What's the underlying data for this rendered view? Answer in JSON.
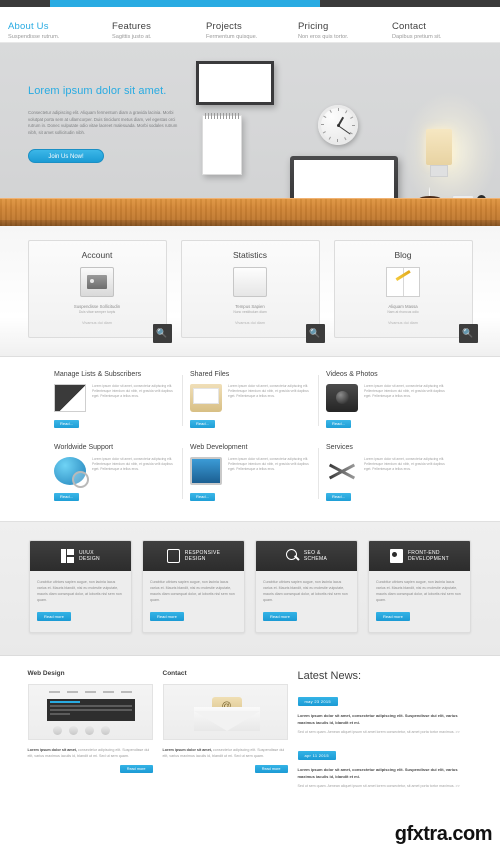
{
  "theme": {
    "accent": "#29abe2",
    "dark": "#3a3a3a",
    "muted": "#a3a3a3"
  },
  "nav": {
    "items": [
      {
        "label": "About Us",
        "sub": "Suspendisse rutrum.",
        "active": true
      },
      {
        "label": "Features",
        "sub": "Sagittis justo at.",
        "active": false
      },
      {
        "label": "Projects",
        "sub": "Fermentum quisque.",
        "active": false
      },
      {
        "label": "Pricing",
        "sub": "Non eros quis tortor.",
        "active": false
      },
      {
        "label": "Contact",
        "sub": "Dapibus pretium sit.",
        "active": false
      }
    ]
  },
  "hero": {
    "title": "Lorem ipsum dolor sit amet.",
    "text": "Consectetur adipiscing elit. Aliquam fermentum diam a gravida lacinia. Morbi volutpat porta sem at ullamcorper. Duis tincidunt metus diam, vel egestas orci rutrum in. Donec vulputate odio vitae laoreet malesuada. Morbi sodales rutrum nibh, sit amet sollicitudin nibh.",
    "button": "Join Us Now!",
    "objects": {
      "picture_frame": "framed-picture",
      "notepad": "spiral-notepad",
      "clock": "wall-clock",
      "monitor": "desktop-monitor",
      "lamp": "wall-lamp",
      "coffee": "coffee-cup",
      "outlet": "power-outlet"
    }
  },
  "cards3": [
    {
      "title": "Account",
      "icon": "safe-icon",
      "line1": "Suspendisse Sollicitudin",
      "line2": "Duis vitae semper turpis",
      "line3": "Vivamus dui diam",
      "search": "search-icon"
    },
    {
      "title": "Statistics",
      "icon": "chart-monitor-icon",
      "line1": "Tempus Sapien",
      "line2": "Nunc vestibulum diam",
      "line3": "Vivamus dui diam",
      "search": "search-icon"
    },
    {
      "title": "Blog",
      "icon": "notebook-pencil-icon",
      "line1": "Aliquam Massa",
      "line2": "Nam at rhoncus odio",
      "line3": "Vivamus dui diam",
      "search": "search-icon"
    }
  ],
  "services": {
    "body": "Lorem ipsum dolor sit amet, consectetur adipiscing elit. Pellentesque interdum dui nibh, et gravida velit dapibus eget. Pellentesque a tellus eros.",
    "read_label": "Read...",
    "items": [
      {
        "title": "Manage Lists & Subscribers",
        "icon": "notebook-icon"
      },
      {
        "title": "Shared Files",
        "icon": "folder-icon"
      },
      {
        "title": "Videos & Photos",
        "icon": "camera-icon"
      },
      {
        "title": "Worldwide Support",
        "icon": "globe-magnifier-icon"
      },
      {
        "title": "Web Development",
        "icon": "laptop-icon"
      },
      {
        "title": "Services",
        "icon": "tools-icon"
      }
    ]
  },
  "cards4": {
    "body": "Curabitur ultrices sapien augue, non lacinia lacus varius et. Mauris blandit, nisi eu molestie vulputate, mauris diam consequat dolor, at lobortis nisl sem non quam.",
    "read_label": "Read more",
    "items": [
      {
        "line1": "UI/UX",
        "line2": "DESIGN",
        "icon": "layout-grid-icon"
      },
      {
        "line1": "RESPONSIVE",
        "line2": "DESIGN",
        "icon": "mobile-phone-icon"
      },
      {
        "line1": "SEO &",
        "line2": "SCHEMA",
        "icon": "magnifier-icon"
      },
      {
        "line1": "FRONT-END",
        "line2": "DEVELOPMENT",
        "icon": "code-window-icon"
      }
    ]
  },
  "bottom": {
    "web_design": {
      "title": "Web Design",
      "image": "browser-window-screenshot",
      "lead": "Lorem ipsum dolor sit amet,",
      "text": " consectetur adipiscing elit. Suspendisse dui elit, varius maximus iaculis id, blandit ut mi. Sed ut sem quam.",
      "button": "Read more"
    },
    "contact": {
      "title": "Contact",
      "image": "envelope-at-icon",
      "lead": "Lorem ipsum dolor sit amet,",
      "text": " consectetur adipiscing elit. Suspendisse dui elit, varius maximus iaculis id, blandit ut mi. Sed ut sem quam.",
      "button": "Read more"
    },
    "news": {
      "title": "Latest News:",
      "items": [
        {
          "date": "may 23 2015",
          "lead": "Lorem ipsum dolor sit amet, consectetur adipiscing elit. Suspendisse dui elit, varius maximus iaculis id, blandit et mi.",
          "sub": "Sed ut sem quam. Aenean aliquet ipsum sit amet lorem consectetur, sit amet porta tortor maximus. >>"
        },
        {
          "date": "apr 11 2015",
          "lead": "Lorem ipsum dolor sit amet, consectetur adipiscing elit. Suspendisse dui elit, varius maximus iaculis id, blandit et mi.",
          "sub": "Sed ut sem quam. Aenean aliquet ipsum sit amet lorem consectetur, sit amet porta tortor maximus. >>"
        }
      ]
    }
  },
  "watermark": "gfxtra.com"
}
